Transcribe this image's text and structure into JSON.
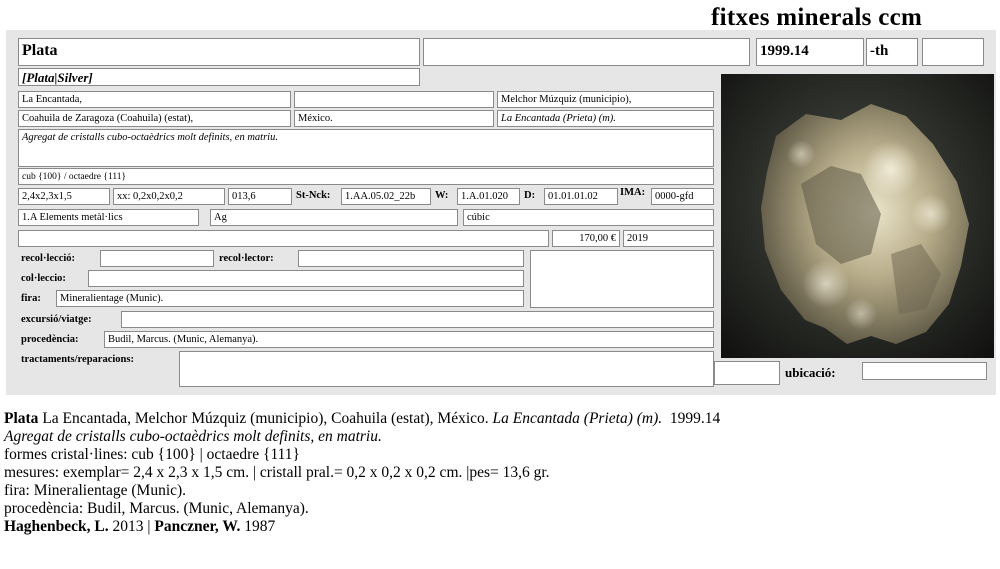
{
  "header": {
    "title": "fitxes minerals ccm"
  },
  "card": {
    "name": "Plata",
    "ref": "1999.14",
    "suffix": "-th",
    "synonyms": "[Plata|Silver]",
    "loc_1": "La Encantada,",
    "loc_2": "",
    "loc_3": "Melchor Múzquiz (municipio),",
    "loc_4": "Coahuila de Zaragoza (Coahuila) (estat),",
    "loc_5": "México.",
    "loc_6": "La Encantada (Prieta) (m).",
    "description": "Agregat de cristalls cubo-octaèdrics molt definits, en matriu.",
    "forms": "cub {100} / octaedre {111}",
    "dims": "2,4x2,3x1,5",
    "xx": "xx: 0,2x0,2x0,2",
    "weight": "013,6",
    "stnck_label": "St-Nck:",
    "stnck": "1.AA.05.02_22b",
    "w_label": "W:",
    "w": "1.A.01.020",
    "d_label": "D:",
    "d": "01.01.01.02",
    "ima_label": "IMA:",
    "ima": "0000-gfd",
    "class": "1.A Elements metàl·lics",
    "formula": "Ag",
    "system": "cúbic",
    "price": "170,00 €",
    "year": "2019",
    "recoleccio_label": "recol·lecció:",
    "recolector_label": "recol·lector:",
    "colleccio_label": "col·leccio:",
    "fira_label": "fira:",
    "fira": "Mineralientage (Munic).",
    "excursio_label": "excursió/viatge:",
    "procedencia_label": "procedència:",
    "procedencia": "Budil, Marcus. (Munic, Alemanya).",
    "tractaments_label": "tractaments/reparacions:",
    "ubicacio_label": "ubicació:"
  },
  "caption": {
    "l1_name": "Plata",
    "l1_loc": " La Encantada, Melchor Múzquiz (municipio), Coahuila (estat), México. ",
    "l1_it": "La Encantada (Prieta) (m).",
    "l1_ref": "  1999.14",
    "l2": "Agregat de cristalls cubo-octaèdrics molt definits, en matriu.",
    "l3": "formes cristal·lines: cub {100} | octaedre {111}",
    "l4": "mesures: exemplar= 2,4 x 2,3 x 1,5 cm. | cristall pral.= 0,2 x 0,2 x 0,2 cm. |pes= 13,6 gr.",
    "l5": "fira: Mineralientage (Munic).",
    "l6": "procedència: Budil, Marcus. (Munic, Alemanya).",
    "l7_a": "Haghenbeck, L.",
    "l7_b": " 2013 | ",
    "l7_c": "Panczner, W.",
    "l7_d": " 1987"
  }
}
